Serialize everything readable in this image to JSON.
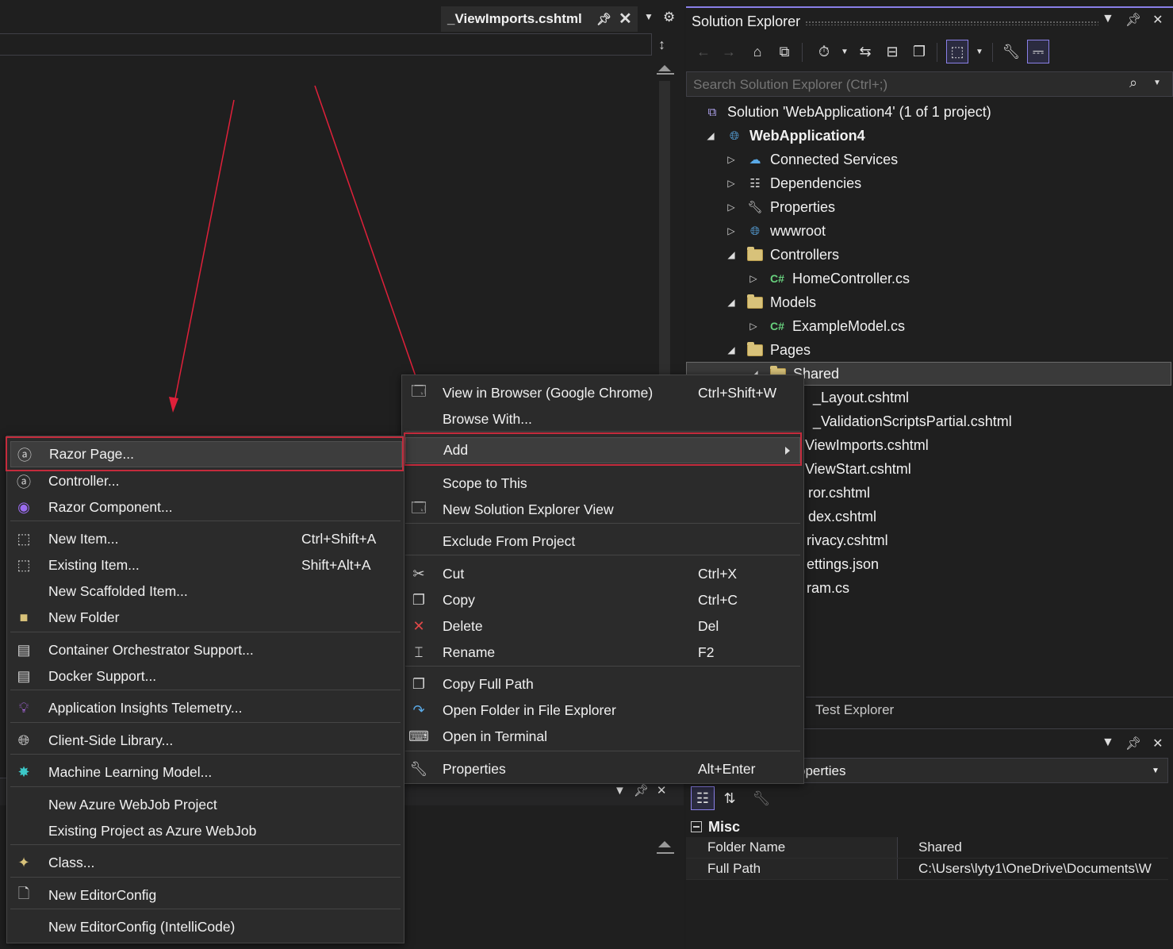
{
  "editor": {
    "tab_title": "_ViewImports.cshtml"
  },
  "solution_explorer": {
    "title": "Solution Explorer",
    "search_placeholder": "Search Solution Explorer (Ctrl+;)",
    "tree": [
      {
        "label": "Solution 'WebApplication4' (1 of 1 project)",
        "icon": "solution-icon"
      },
      {
        "label": "WebApplication4",
        "icon": "web-project-icon",
        "bold": true
      },
      {
        "label": "Connected Services",
        "icon": "connected-services-icon"
      },
      {
        "label": "Dependencies",
        "icon": "dependencies-icon"
      },
      {
        "label": "Properties",
        "icon": "properties-wrench-icon"
      },
      {
        "label": "wwwroot",
        "icon": "globe-icon"
      },
      {
        "label": "Controllers",
        "icon": "folder-icon"
      },
      {
        "label": "HomeController.cs",
        "icon": "csharp-file-icon"
      },
      {
        "label": "Models",
        "icon": "folder-icon"
      },
      {
        "label": "ExampleModel.cs",
        "icon": "csharp-file-icon"
      },
      {
        "label": "Pages",
        "icon": "folder-icon"
      },
      {
        "label": "Shared",
        "icon": "folder-icon",
        "selected": true
      },
      {
        "label": "_Layout.cshtml",
        "icon": "razor-file-icon"
      },
      {
        "label": "_ValidationScriptsPartial.cshtml",
        "icon": "razor-file-icon"
      },
      {
        "label": "ViewImports.cshtml",
        "icon": "razor-file-icon"
      },
      {
        "label": "ViewStart.cshtml",
        "icon": "razor-file-icon"
      },
      {
        "label": "ror.cshtml",
        "icon": "razor-file-icon"
      },
      {
        "label": "dex.cshtml",
        "icon": "razor-file-icon"
      },
      {
        "label": "rivacy.cshtml",
        "icon": "razor-file-icon"
      },
      {
        "label": "ettings.json",
        "icon": "json-file-icon"
      },
      {
        "label": "ram.cs",
        "icon": "csharp-file-icon"
      }
    ]
  },
  "test_explorer_tab": "Test Explorer",
  "properties": {
    "object_label": "operties",
    "category": "Misc",
    "rows": [
      {
        "name": "Folder Name",
        "value": "Shared"
      },
      {
        "name": "Full Path",
        "value": "C:\\Users\\lyty1\\OneDrive\\Documents\\W"
      }
    ]
  },
  "context_menu": {
    "items": [
      {
        "label": "View in Browser (Google Chrome)",
        "shortcut": "Ctrl+Shift+W",
        "icon": "browser-icon"
      },
      {
        "label": "Browse With...",
        "shortcut": "",
        "icon": ""
      },
      {
        "label": "Add",
        "shortcut": "",
        "icon": "",
        "submenu": true,
        "highlighted": true
      },
      {
        "label": "Scope to This",
        "shortcut": "",
        "icon": ""
      },
      {
        "label": "New Solution Explorer View",
        "shortcut": "",
        "icon": "new-view-icon"
      },
      {
        "label": "Exclude From Project",
        "shortcut": "",
        "icon": ""
      },
      {
        "label": "Cut",
        "shortcut": "Ctrl+X",
        "icon": "scissors-icon"
      },
      {
        "label": "Copy",
        "shortcut": "Ctrl+C",
        "icon": "copy-icon"
      },
      {
        "label": "Delete",
        "shortcut": "Del",
        "icon": "delete-x-icon"
      },
      {
        "label": "Rename",
        "shortcut": "F2",
        "icon": "rename-icon"
      },
      {
        "label": "Copy Full Path",
        "shortcut": "",
        "icon": "copy-path-icon"
      },
      {
        "label": "Open Folder in File Explorer",
        "shortcut": "",
        "icon": "open-folder-arrow-icon"
      },
      {
        "label": "Open in Terminal",
        "shortcut": "",
        "icon": "terminal-icon"
      },
      {
        "label": "Properties",
        "shortcut": "Alt+Enter",
        "icon": "wrench-icon"
      }
    ]
  },
  "add_submenu": {
    "items": [
      {
        "label": "Razor Page...",
        "shortcut": "",
        "icon": "razor-page-icon",
        "highlighted": true
      },
      {
        "label": "Controller...",
        "shortcut": "",
        "icon": "controller-icon"
      },
      {
        "label": "Razor Component...",
        "shortcut": "",
        "icon": "razor-component-icon"
      },
      {
        "label": "New Item...",
        "shortcut": "Ctrl+Shift+A",
        "icon": "new-item-icon"
      },
      {
        "label": "Existing Item...",
        "shortcut": "Shift+Alt+A",
        "icon": "existing-item-icon"
      },
      {
        "label": "New Scaffolded Item...",
        "shortcut": "",
        "icon": ""
      },
      {
        "label": "New Folder",
        "shortcut": "",
        "icon": "new-folder-icon"
      },
      {
        "label": "Container Orchestrator Support...",
        "shortcut": "",
        "icon": "container-icon"
      },
      {
        "label": "Docker Support...",
        "shortcut": "",
        "icon": "docker-icon"
      },
      {
        "label": "Application Insights Telemetry...",
        "shortcut": "",
        "icon": "app-insights-icon"
      },
      {
        "label": "Client-Side Library...",
        "shortcut": "",
        "icon": "client-library-icon"
      },
      {
        "label": "Machine Learning Model...",
        "shortcut": "",
        "icon": "ml-model-icon"
      },
      {
        "label": "New Azure WebJob Project",
        "shortcut": "",
        "icon": ""
      },
      {
        "label": "Existing Project as Azure WebJob",
        "shortcut": "",
        "icon": ""
      },
      {
        "label": "Class...",
        "shortcut": "",
        "icon": "class-icon"
      },
      {
        "label": "New EditorConfig",
        "shortcut": "",
        "icon": "editorconfig-icon"
      },
      {
        "label": "New EditorConfig (IntelliCode)",
        "shortcut": "",
        "icon": ""
      }
    ]
  },
  "colors": {
    "accent": "#8a80e8",
    "highlight_outline": "#c42b3c",
    "annotation_arrow": "#e0203a"
  }
}
